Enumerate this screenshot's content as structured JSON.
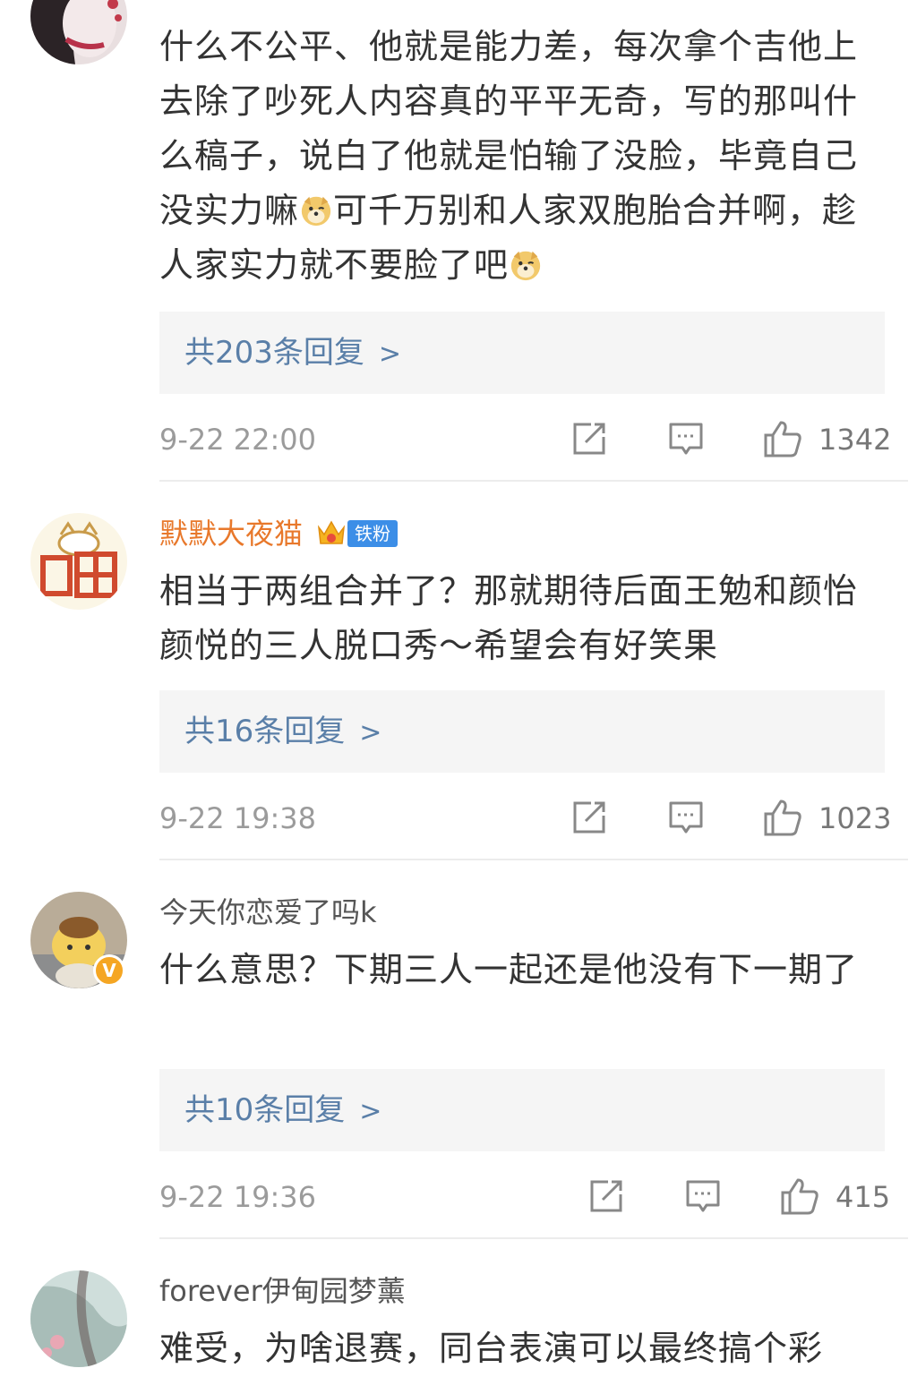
{
  "comments": [
    {
      "username": "",
      "text_parts": [
        "什么不公平、他就是能力差，每次拿个吉他上去除了吵死人内容真的平平无奇，写的那叫什么稿子，说白了他就是怕输了没脸，毕竟自己没实力嘛",
        "可千万别和人家双胞胎合并啊，趁人家实力就不要脸了吧",
        ""
      ],
      "replies_label": "共203条回复",
      "time": "9-22 22:00",
      "likes": "1342"
    },
    {
      "username": "默默大夜猫",
      "fan_badge": "铁粉",
      "crown_level": "5",
      "text": "相当于两组合并了？那就期待后面王勉和颜怡颜悦的三人脱口秀～希望会有好笑果",
      "replies_label": "共16条回复",
      "time": "9-22 19:38",
      "likes": "1023"
    },
    {
      "username": "今天你恋爱了吗k",
      "text": "什么意思？下期三人一起还是他没有下一期了",
      "replies_label": "共10条回复",
      "time": "9-22 19:36",
      "likes": "415"
    },
    {
      "username": "forever伊甸园梦薰",
      "text": "难受，为啥退赛，同台表演可以最终搞个彩"
    }
  ],
  "icons": {
    "repost": "repost-icon",
    "comment": "comment-icon",
    "like": "thumbs-up-icon",
    "chevron": "chevron-right-icon",
    "emoji": "doge-emoji-icon",
    "verified": "verified-v-icon",
    "crown": "crown-icon"
  },
  "colors": {
    "link": "#5a7fa8",
    "username_highlight": "#e8782b",
    "verified": "#f5a623",
    "fan_badge": "#3c8ee7"
  }
}
